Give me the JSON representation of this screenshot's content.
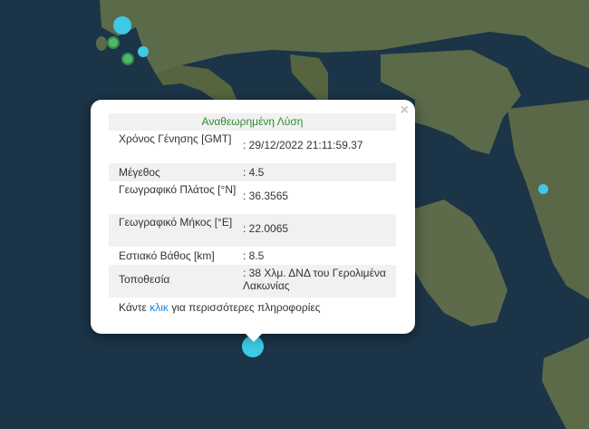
{
  "map": {
    "colors": {
      "sea": "#1b3447",
      "land": "#5b6a49",
      "marker": "#3ec9e6",
      "marker_green": "#4fb96a"
    },
    "markers": [
      {
        "name": "epicenter-marker",
        "type": "main"
      },
      {
        "name": "marker-north-a",
        "type": "small"
      },
      {
        "name": "marker-north-b",
        "type": "small"
      },
      {
        "name": "marker-north-c",
        "type": "small"
      },
      {
        "name": "marker-north-d",
        "type": "small"
      },
      {
        "name": "marker-east",
        "type": "small"
      }
    ]
  },
  "popup": {
    "header": "Αναθεωρημένη Λύση",
    "close_icon": "×",
    "rows": [
      {
        "label": "Χρόνος Γένησης [GMT]",
        "value": ": 29/12/2022 21:11:59.37"
      },
      {
        "label": "Μέγεθος",
        "value": ": 4.5"
      },
      {
        "label": "Γεωγραφικό Πλάτος [°N]",
        "value": ": 36.3565"
      },
      {
        "label": "Γεωγραφικό Μήκος [°E]",
        "value": ": 22.0065"
      },
      {
        "label": "Εστιακό Βάθος [km]",
        "value": ": 8.5"
      },
      {
        "label": "Τοποθεσία",
        "value": ": 38 Χλμ. ΔΝΔ του Γερολιμένα Λακωνίας"
      }
    ],
    "more_prefix": "Κάντε ",
    "more_link": "κλικ",
    "more_suffix": " για περισσότερες πληροφορίες"
  }
}
